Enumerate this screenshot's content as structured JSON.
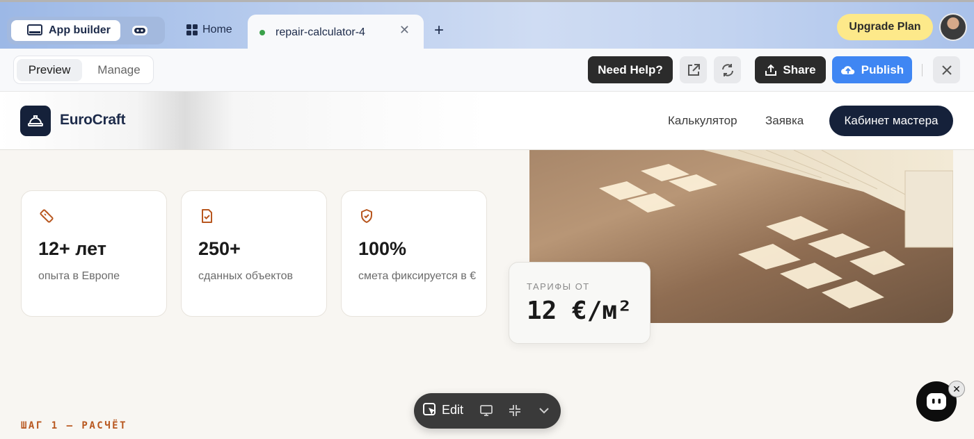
{
  "tabs": {
    "app_builder": "App builder",
    "home": "Home",
    "active": "repair-calculator-4",
    "upgrade": "Upgrade Plan"
  },
  "toolbar": {
    "preview": "Preview",
    "manage": "Manage",
    "help": "Need Help?",
    "share": "Share",
    "publish": "Publish"
  },
  "site": {
    "brand": "EuroCraft",
    "nav": [
      "Калькулятор",
      "Заявка"
    ],
    "cta": "Кабинет мастера"
  },
  "stats": [
    {
      "icon": "ruler-icon",
      "value": "12+ лет",
      "label": "опыта в Европе"
    },
    {
      "icon": "document-check-icon",
      "value": "250+",
      "label": "сданных объектов"
    },
    {
      "icon": "shield-check-icon",
      "value": "100%",
      "label": "смета фиксируется в €"
    }
  ],
  "price": {
    "label": "ТАРИФЫ ОТ",
    "value": "12 €/м²"
  },
  "step_label": "ШАГ 1 — РАСЧЁТ",
  "editbar": {
    "edit": "Edit"
  },
  "colors": {
    "accent": "#3f86f3",
    "brand_dark": "#15213a",
    "icon_orange": "#b8571f",
    "upgrade_bg": "#fde98a"
  }
}
